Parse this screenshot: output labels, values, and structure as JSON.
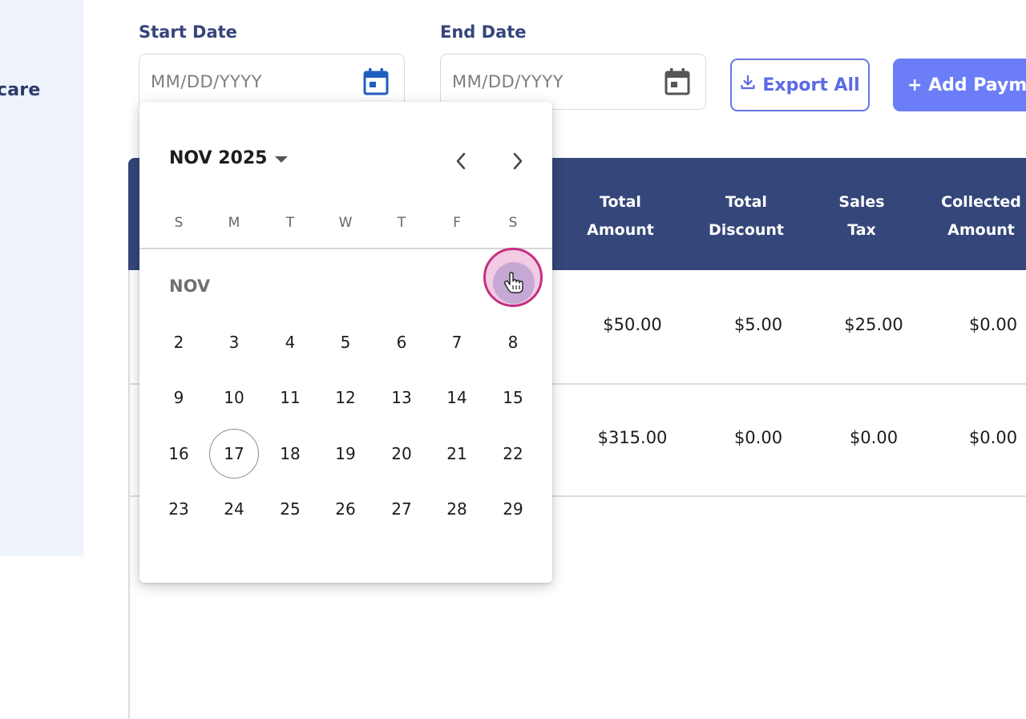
{
  "sidebar": {
    "label": "care"
  },
  "filters": {
    "start_date": {
      "label": "Start Date",
      "placeholder": "MM/DD/YYYY",
      "icon": "calendar-icon"
    },
    "end_date": {
      "label": "End Date",
      "placeholder": "MM/DD/YYYY",
      "icon": "calendar-icon"
    }
  },
  "actions": {
    "export_label": "Export All",
    "add_label": "+ Add Paym"
  },
  "table": {
    "headers": [
      {
        "line1": "Total",
        "line2": "Amount"
      },
      {
        "line1": "Total",
        "line2": "Discount"
      },
      {
        "line1": "Sales",
        "line2": "Tax"
      },
      {
        "line1": "Collected",
        "line2": "Amount"
      }
    ],
    "rows": [
      [
        "$50.00",
        "$5.00",
        "$25.00",
        "$0.00"
      ],
      [
        "$315.00",
        "$0.00",
        "$0.00",
        "$0.00"
      ]
    ]
  },
  "datepicker": {
    "month_year": "NOV 2025",
    "month_label": "NOV",
    "weekdays": [
      "S",
      "M",
      "T",
      "W",
      "T",
      "F",
      "S"
    ],
    "weeks": [
      [
        "2",
        "3",
        "4",
        "5",
        "6",
        "7",
        "8"
      ],
      [
        "9",
        "10",
        "11",
        "12",
        "13",
        "14",
        "15"
      ],
      [
        "16",
        "17",
        "18",
        "19",
        "20",
        "21",
        "22"
      ],
      [
        "23",
        "24",
        "25",
        "26",
        "27",
        "28",
        "29"
      ]
    ],
    "today": "17",
    "colors": {
      "accent": "#6b7ef7",
      "header": "#35467a",
      "calendar_active": "#1f5fbf"
    }
  }
}
